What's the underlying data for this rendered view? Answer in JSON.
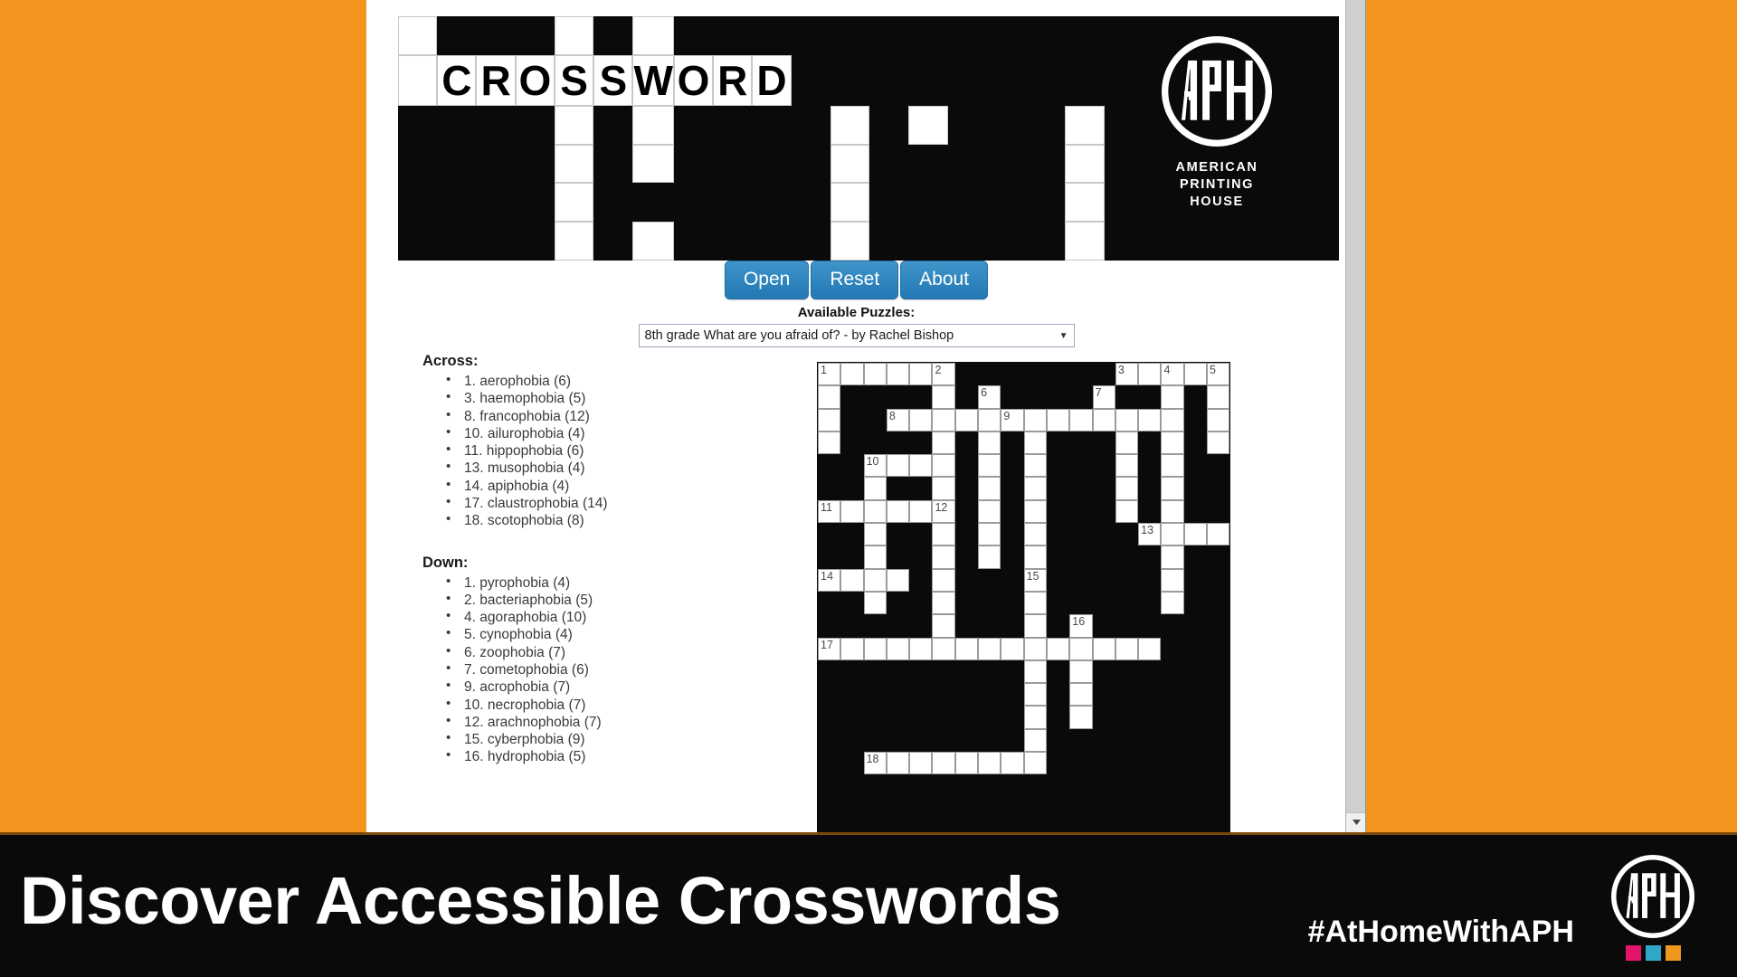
{
  "banner": {
    "word": "CROSSWORD",
    "letters": [
      "C",
      "R",
      "O",
      "S",
      "S",
      "W",
      "O",
      "R",
      "D"
    ],
    "logo_name": "aph-logo",
    "org_lines": [
      "AMERICAN",
      "PRINTING",
      "HOUSE"
    ]
  },
  "toolbar": {
    "open_label": "Open",
    "reset_label": "Reset",
    "about_label": "About"
  },
  "puzzle_selector": {
    "label": "Available Puzzles:",
    "selected": "8th grade What are you afraid of? - by Rachel Bishop",
    "caret": "▼"
  },
  "clues": {
    "across_heading": "Across:",
    "across": [
      "1. aerophobia (6)",
      "3. haemophobia (5)",
      "8. francophobia (12)",
      "10. ailurophobia (4)",
      "11. hippophobia (6)",
      "13. musophobia (4)",
      "14. apiphobia (4)",
      "17. claustrophobia (14)",
      "18. scotophobia (8)"
    ],
    "down_heading": "Down:",
    "down": [
      "1. pyrophobia (4)",
      "2. bacteriaphobia (5)",
      "4. agoraphobia (10)",
      "5. cynophobia (4)",
      "6. zoophobia (7)",
      "7. cometophobia (6)",
      "9. acrophobia (7)",
      "10. necrophobia (7)",
      "12. arachnophobia (7)",
      "15. cyberphobia (9)",
      "16. hydrophobia (5)"
    ]
  },
  "grid": {
    "cols": 18,
    "rows": 21,
    "cells": [
      [
        1,
        1,
        1,
        1,
        1,
        1,
        0,
        0,
        0,
        0,
        0,
        0,
        0,
        1,
        1,
        1,
        1,
        1
      ],
      [
        1,
        0,
        0,
        0,
        0,
        1,
        0,
        1,
        0,
        0,
        0,
        0,
        1,
        0,
        0,
        1,
        0,
        1
      ],
      [
        1,
        0,
        0,
        1,
        1,
        1,
        1,
        1,
        1,
        1,
        1,
        1,
        1,
        1,
        1,
        1,
        0,
        1
      ],
      [
        1,
        0,
        0,
        0,
        0,
        1,
        0,
        1,
        0,
        1,
        0,
        0,
        0,
        1,
        0,
        1,
        0,
        1
      ],
      [
        0,
        0,
        1,
        1,
        1,
        1,
        0,
        1,
        0,
        1,
        0,
        0,
        0,
        1,
        0,
        1,
        0,
        0
      ],
      [
        0,
        0,
        1,
        0,
        0,
        1,
        0,
        1,
        0,
        1,
        0,
        0,
        0,
        1,
        0,
        1,
        0,
        0
      ],
      [
        1,
        1,
        1,
        1,
        1,
        1,
        0,
        1,
        0,
        1,
        0,
        0,
        0,
        1,
        0,
        1,
        0,
        0
      ],
      [
        0,
        0,
        1,
        0,
        0,
        1,
        0,
        1,
        0,
        1,
        0,
        0,
        0,
        0,
        1,
        1,
        1,
        1
      ],
      [
        0,
        0,
        1,
        0,
        0,
        1,
        0,
        1,
        0,
        1,
        0,
        0,
        0,
        0,
        0,
        1,
        0,
        0
      ],
      [
        1,
        1,
        1,
        1,
        0,
        1,
        0,
        0,
        0,
        1,
        0,
        0,
        0,
        0,
        0,
        1,
        0,
        0
      ],
      [
        0,
        0,
        1,
        0,
        0,
        1,
        0,
        0,
        0,
        1,
        0,
        0,
        0,
        0,
        0,
        1,
        0,
        0
      ],
      [
        0,
        0,
        0,
        0,
        0,
        1,
        0,
        0,
        0,
        1,
        0,
        1,
        0,
        0,
        0,
        0,
        0,
        0
      ],
      [
        1,
        1,
        1,
        1,
        1,
        1,
        1,
        1,
        1,
        1,
        1,
        1,
        1,
        1,
        1,
        0,
        0,
        0
      ],
      [
        0,
        0,
        0,
        0,
        0,
        0,
        0,
        0,
        0,
        1,
        0,
        1,
        0,
        0,
        0,
        0,
        0,
        0
      ],
      [
        0,
        0,
        0,
        0,
        0,
        0,
        0,
        0,
        0,
        1,
        0,
        1,
        0,
        0,
        0,
        0,
        0,
        0
      ],
      [
        0,
        0,
        0,
        0,
        0,
        0,
        0,
        0,
        0,
        1,
        0,
        1,
        0,
        0,
        0,
        0,
        0,
        0
      ],
      [
        0,
        0,
        0,
        0,
        0,
        0,
        0,
        0,
        0,
        1,
        0,
        0,
        0,
        0,
        0,
        0,
        0,
        0
      ],
      [
        0,
        0,
        1,
        1,
        1,
        1,
        1,
        1,
        1,
        1,
        0,
        0,
        0,
        0,
        0,
        0,
        0,
        0
      ],
      [
        0,
        0,
        0,
        0,
        0,
        0,
        0,
        0,
        0,
        0,
        0,
        0,
        0,
        0,
        0,
        0,
        0,
        0
      ],
      [
        0,
        0,
        0,
        0,
        0,
        0,
        0,
        0,
        0,
        0,
        0,
        0,
        0,
        0,
        0,
        0,
        0,
        0
      ],
      [
        0,
        0,
        0,
        0,
        0,
        0,
        0,
        0,
        0,
        0,
        0,
        0,
        0,
        0,
        0,
        0,
        0,
        0
      ]
    ],
    "numbers": [
      {
        "r": 0,
        "c": 0,
        "n": "1"
      },
      {
        "r": 0,
        "c": 5,
        "n": "2"
      },
      {
        "r": 0,
        "c": 13,
        "n": "3"
      },
      {
        "r": 0,
        "c": 15,
        "n": "4"
      },
      {
        "r": 0,
        "c": 17,
        "n": "5"
      },
      {
        "r": 1,
        "c": 7,
        "n": "6"
      },
      {
        "r": 1,
        "c": 12,
        "n": "7"
      },
      {
        "r": 2,
        "c": 3,
        "n": "8"
      },
      {
        "r": 2,
        "c": 8,
        "n": "9"
      },
      {
        "r": 4,
        "c": 2,
        "n": "10"
      },
      {
        "r": 6,
        "c": 0,
        "n": "11"
      },
      {
        "r": 6,
        "c": 5,
        "n": "12"
      },
      {
        "r": 7,
        "c": 14,
        "n": "13"
      },
      {
        "r": 9,
        "c": 0,
        "n": "14"
      },
      {
        "r": 9,
        "c": 9,
        "n": "15"
      },
      {
        "r": 11,
        "c": 11,
        "n": "16"
      },
      {
        "r": 12,
        "c": 0,
        "n": "17"
      },
      {
        "r": 17,
        "c": 2,
        "n": "18"
      }
    ]
  },
  "bottom_bar": {
    "title": "Discover Accessible Crosswords",
    "hashtag": "#AtHomeWithAPH",
    "logo_name": "aph-logo",
    "swatches": [
      "#E5146B",
      "#2FA8C8",
      "#F0981E"
    ]
  },
  "colors": {
    "page_background": "#F3941F",
    "button": "#2e86c1",
    "bar_background": "#0a0a0a"
  },
  "scrollbar": {
    "down_arrow": "▼"
  }
}
